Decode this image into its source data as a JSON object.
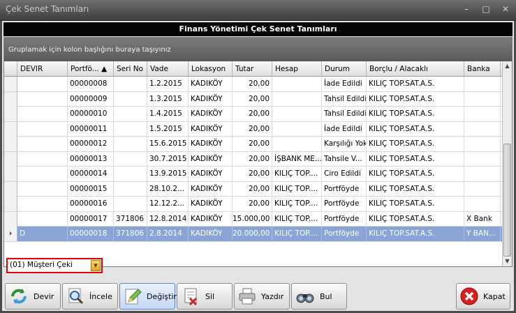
{
  "window": {
    "title": "Çek Senet Tanımları",
    "controls": [
      "–",
      "□",
      "✕"
    ]
  },
  "banner": "Finans Yönetimi Çek Senet Tanımları",
  "grid": {
    "group_hint": "Gruplamak için kolon başlığını buraya taşıyınız",
    "columns": [
      "DEVIR",
      "Portfö... ▲",
      "Seri No",
      "Vade",
      "Lokasyon",
      "Tutar",
      "Hesap",
      "Durum",
      "Borçlu / Alacaklı",
      "Banka"
    ],
    "rows": [
      {
        "ind": "",
        "devir": "",
        "portfoy": "00000008",
        "seri": "",
        "vade": "1.2.2015",
        "lokasyon": "KADIKÖY",
        "tutar": "20,00",
        "hesap": "",
        "durum": "İade Edildi",
        "borclu": "KILIÇ TOP.SAT.A.S.",
        "banka": ""
      },
      {
        "ind": "",
        "devir": "",
        "portfoy": "00000009",
        "seri": "",
        "vade": "1.3.2015",
        "lokasyon": "KADIKÖY",
        "tutar": "20,00",
        "hesap": "",
        "durum": "Tahsil Edildi",
        "borclu": "KILIÇ TOP.SAT.A.S.",
        "banka": ""
      },
      {
        "ind": "",
        "devir": "",
        "portfoy": "00000010",
        "seri": "",
        "vade": "1.4.2015",
        "lokasyon": "KADIKÖY",
        "tutar": "20,00",
        "hesap": "",
        "durum": "Tahsil Edildi",
        "borclu": "KILIÇ TOP.SAT.A.S.",
        "banka": ""
      },
      {
        "ind": "",
        "devir": "",
        "portfoy": "00000011",
        "seri": "",
        "vade": "1.5.2015",
        "lokasyon": "KADIKÖY",
        "tutar": "20,00",
        "hesap": "",
        "durum": "İade Edildi",
        "borclu": "KILIÇ TOP.SAT.A.S.",
        "banka": ""
      },
      {
        "ind": "",
        "devir": "",
        "portfoy": "00000012",
        "seri": "",
        "vade": "15.6.2015",
        "lokasyon": "KADIKÖY",
        "tutar": "20,00",
        "hesap": "",
        "durum": "Karşılığı Yok",
        "borclu": "KILIÇ TOP.SAT.A.S.",
        "banka": ""
      },
      {
        "ind": "",
        "devir": "",
        "portfoy": "00000013",
        "seri": "",
        "vade": "30.7.2015",
        "lokasyon": "KADIKÖY",
        "tutar": "20,00",
        "hesap": "İŞBANK ME...",
        "durum": "Tahsile V...",
        "borclu": "KILIÇ TOP.SAT.A.S.",
        "banka": ""
      },
      {
        "ind": "",
        "devir": "",
        "portfoy": "00000014",
        "seri": "",
        "vade": "13.9.2015",
        "lokasyon": "KADIKÖY",
        "tutar": "20,00",
        "hesap": "KILIÇ TOP....",
        "durum": "Ciro Edildi",
        "borclu": "KILIÇ TOP.SAT.A.S.",
        "banka": ""
      },
      {
        "ind": "",
        "devir": "",
        "portfoy": "00000015",
        "seri": "",
        "vade": "28.10.2...",
        "lokasyon": "KADIKÖY",
        "tutar": "20,00",
        "hesap": "KILIÇ TOP....",
        "durum": "Portföyde",
        "borclu": "KILIÇ TOP.SAT.A.S.",
        "banka": ""
      },
      {
        "ind": "",
        "devir": "",
        "portfoy": "00000016",
        "seri": "",
        "vade": "12.12.2...",
        "lokasyon": "KADIKÖY",
        "tutar": "20,00",
        "hesap": "KILIÇ TOP....",
        "durum": "Portföyde",
        "borclu": "KILIÇ TOP.SAT.A.S.",
        "banka": ""
      },
      {
        "ind": "",
        "devir": "",
        "portfoy": "00000017",
        "seri": "371806",
        "vade": "12.8.2014",
        "lokasyon": "KADIKÖY",
        "tutar": "15.000,00",
        "hesap": "KILIÇ TOP....",
        "durum": "Portföyde",
        "borclu": "KILIÇ TOP.SAT.A.S.",
        "banka": "X Bank"
      },
      {
        "ind": "›",
        "devir": "D",
        "portfoy": "00000018",
        "seri": "371806",
        "vade": "2.8.2014",
        "lokasyon": "KADIKÖY",
        "tutar": "20.000,00",
        "hesap": "KILIÇ TOP....",
        "durum": "Portföyde",
        "borclu": "KILIÇ TOP.SAT.A.S.",
        "banka": "Y BAN..."
      }
    ],
    "selected_row": 10
  },
  "filter": {
    "value": "(01) Müşteri Çeki"
  },
  "toolbar": {
    "buttons": [
      {
        "label": "Devir",
        "icon": "refresh-arrows-icon"
      },
      {
        "label": "İncele",
        "icon": "magnifier-icon"
      },
      {
        "label": "Değiştir",
        "icon": "pencil-edit-icon"
      },
      {
        "label": "Sil",
        "icon": "delete-document-icon"
      },
      {
        "label": "Yazdır",
        "icon": "printer-icon"
      },
      {
        "label": "Bul",
        "icon": "binoculars-icon"
      }
    ],
    "close_label": "Kapat",
    "close_icon": "close-x-icon"
  },
  "colors": {
    "selected_row": "#8aa4d6",
    "highlight_border": "#e00000",
    "banner": "#050505"
  }
}
